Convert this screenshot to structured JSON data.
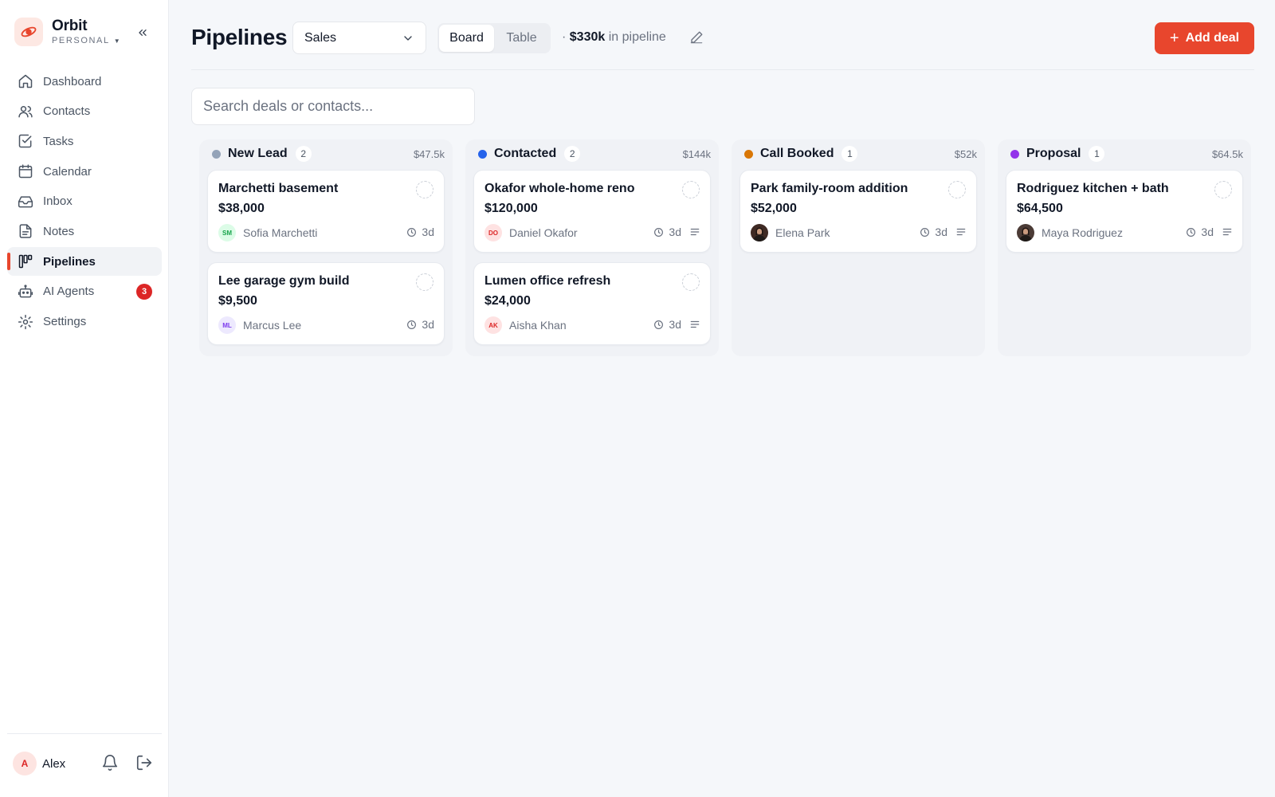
{
  "app": {
    "name": "Orbit",
    "workspace": "PERSONAL"
  },
  "nav": [
    {
      "label": "Dashboard",
      "icon": "home-icon",
      "active": false
    },
    {
      "label": "Contacts",
      "icon": "users-icon",
      "active": false
    },
    {
      "label": "Tasks",
      "icon": "checkbox-icon",
      "active": false
    },
    {
      "label": "Calendar",
      "icon": "calendar-icon",
      "active": false
    },
    {
      "label": "Inbox",
      "icon": "inbox-icon",
      "active": false
    },
    {
      "label": "Notes",
      "icon": "document-icon",
      "active": false
    },
    {
      "label": "Pipelines",
      "icon": "kanban-icon",
      "active": true
    },
    {
      "label": "AI Agents",
      "icon": "robot-icon",
      "active": false,
      "badge": "3"
    },
    {
      "label": "Settings",
      "icon": "gear-icon",
      "active": false
    }
  ],
  "user": {
    "initial": "A",
    "name": "Alex"
  },
  "header": {
    "title": "Pipelines",
    "pipeline_select": "Sales",
    "views": [
      "Board",
      "Table"
    ],
    "active_view": "Board",
    "total_prefix": "·",
    "total_amount": "$330k",
    "total_suffix": "in pipeline",
    "add_button": "Add deal"
  },
  "search": {
    "placeholder": "Search deals or contacts..."
  },
  "colors": {
    "accent": "#e8462d",
    "badge": "#dc2626"
  },
  "columns": [
    {
      "name": "New Lead",
      "count": "2",
      "total": "$47.5k",
      "color": "#94a3b8",
      "cards": [
        {
          "title": "Marchetti basement",
          "value": "$38,000",
          "contact": "Sofia Marchetti",
          "initials": "SM",
          "avatar_bg": "#dcfce7",
          "avatar_fg": "#16a34a",
          "age": "3d",
          "has_notes": false
        },
        {
          "title": "Lee garage gym build",
          "value": "$9,500",
          "contact": "Marcus Lee",
          "initials": "ML",
          "avatar_bg": "#ede9fe",
          "avatar_fg": "#7c3aed",
          "age": "3d",
          "has_notes": false
        }
      ]
    },
    {
      "name": "Contacted",
      "count": "2",
      "total": "$144k",
      "color": "#2563eb",
      "cards": [
        {
          "title": "Okafor whole-home reno",
          "value": "$120,000",
          "contact": "Daniel Okafor",
          "initials": "DO",
          "avatar_bg": "#fee2e2",
          "avatar_fg": "#dc2626",
          "age": "3d",
          "has_notes": true
        },
        {
          "title": "Lumen office refresh",
          "value": "$24,000",
          "contact": "Aisha Khan",
          "initials": "AK",
          "avatar_bg": "#fee2e2",
          "avatar_fg": "#dc2626",
          "age": "3d",
          "has_notes": true
        }
      ]
    },
    {
      "name": "Call Booked",
      "count": "1",
      "total": "$52k",
      "color": "#d97706",
      "cards": [
        {
          "title": "Park family-room addition",
          "value": "$52,000",
          "contact": "Elena Park",
          "initials": "",
          "avatar_bg": "#3f2a24",
          "avatar_fg": "#ffffff",
          "age": "3d",
          "has_notes": true,
          "photo": true
        }
      ]
    },
    {
      "name": "Proposal",
      "count": "1",
      "total": "$64.5k",
      "color": "#9333ea",
      "cards": [
        {
          "title": "Rodriguez kitchen + bath",
          "value": "$64,500",
          "contact": "Maya Rodriguez",
          "initials": "",
          "avatar_bg": "#4b3b36",
          "avatar_fg": "#ffffff",
          "age": "3d",
          "has_notes": true,
          "photo": true
        }
      ]
    }
  ]
}
